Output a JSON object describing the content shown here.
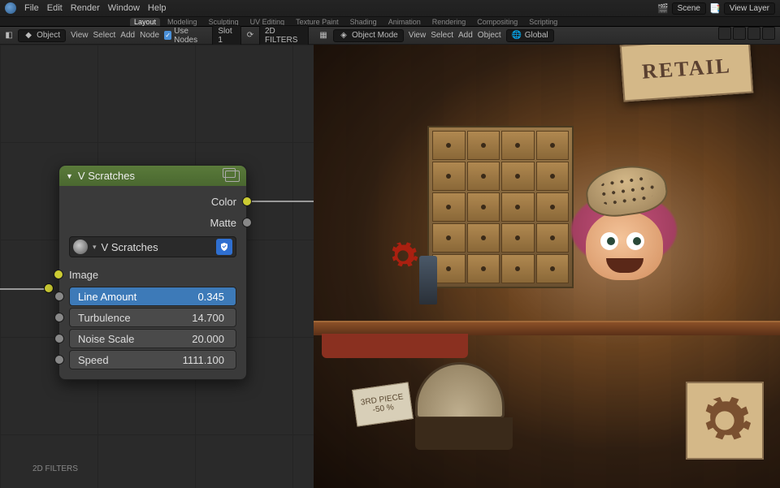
{
  "menubar": {
    "items": [
      "File",
      "Edit",
      "Render",
      "Window",
      "Help"
    ],
    "scene_label": "Scene",
    "viewlayer_label": "View Layer"
  },
  "tabs": {
    "items": [
      "Layout",
      "Modeling",
      "Sculpting",
      "UV Editing",
      "Texture Paint",
      "Shading",
      "Animation",
      "Rendering",
      "Compositing",
      "Scripting"
    ],
    "active": "Layout"
  },
  "left_header": {
    "object_mode": "Object",
    "items": [
      "View",
      "Select",
      "Add",
      "Node"
    ],
    "use_nodes_label": "Use Nodes",
    "slot": "Slot 1",
    "filters": "2D FILTERS"
  },
  "right_header": {
    "mode": "Object Mode",
    "items": [
      "View",
      "Select",
      "Add",
      "Object"
    ],
    "orientation": "Global"
  },
  "node": {
    "title": "V Scratches",
    "outputs": {
      "color": "Color",
      "matte": "Matte"
    },
    "group_name": "V Scratches",
    "inputs": {
      "image": "Image",
      "line_amount": {
        "label": "Line Amount",
        "value": "0.345"
      },
      "turbulence": {
        "label": "Turbulence",
        "value": "14.700"
      },
      "noise_scale": {
        "label": "Noise Scale",
        "value": "20.000"
      },
      "speed": {
        "label": "Speed",
        "value": "1111.100"
      }
    }
  },
  "footer": "2D FILTERS",
  "render": {
    "sign": "RETAIL",
    "price_line1": "3RD PIECE",
    "price_line2": "-50 %"
  }
}
